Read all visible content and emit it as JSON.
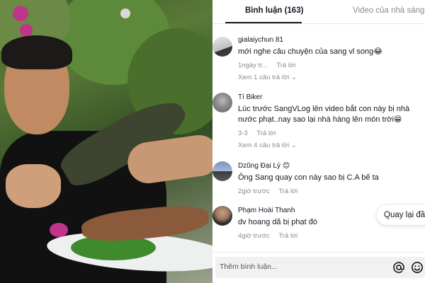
{
  "tabs": [
    {
      "label": "Bình luận (163)",
      "active": true
    },
    {
      "label": "Video của nhà sáng tạ",
      "active": false
    }
  ],
  "comments": [
    {
      "user": "gialaiychun 81",
      "text": "mới nghe câu chuyện của sang vl song",
      "emoji": "😂",
      "time": "1ngày tr...",
      "reply_label": "Trả lời",
      "replies_label": "Xem 1 câu trả lời",
      "avatar_icon": "person-photo-icon"
    },
    {
      "user": "Tí Biker",
      "text": "Lúc trước SangVLog lên video bắt con này bị nhà nước phạt..nay sao lại nhà hàng lên món trời",
      "emoji": "😁",
      "time": "3-3",
      "reply_label": "Trả lời",
      "replies_label": "Xem 4 câu trả lời",
      "avatar_icon": "person-photo-icon"
    },
    {
      "user": "Dzũng Đại Lý",
      "user_emoji": "😊",
      "text": "Ông Sang quay con này sao bị C.A bế ta",
      "time": "2giờ trước",
      "reply_label": "Trả lời",
      "avatar_icon": "person-photo-icon"
    },
    {
      "user": "Phạm Hoài Thanh",
      "text": "dv hoang dã bị phạt đó",
      "time": "4giờ trước",
      "reply_label": "Trả lời",
      "avatar_icon": "person-photo-icon"
    }
  ],
  "back_button": {
    "label": "Quay lại đầu"
  },
  "composer": {
    "placeholder": "Thêm bình luận...",
    "mention_icon": "at-sign-icon",
    "emoji_icon": "smiley-icon"
  },
  "colors": {
    "primary_text": "#161823",
    "secondary_text": "#8a8b91",
    "input_bg": "#f1f1f2"
  }
}
